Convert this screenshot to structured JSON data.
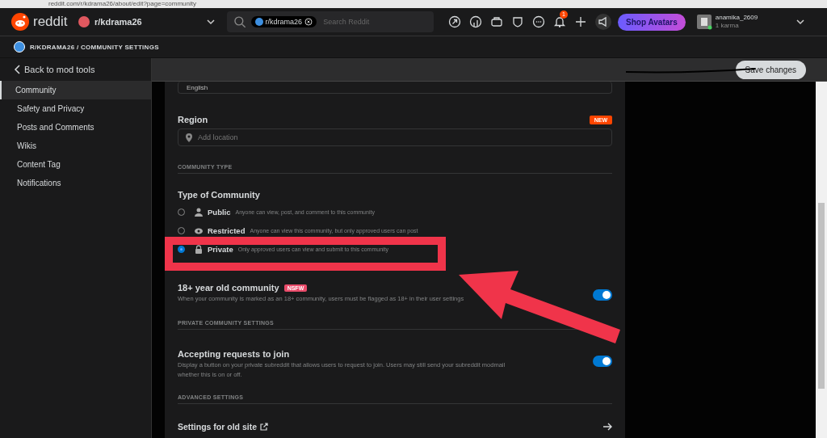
{
  "browser": {
    "url": "reddit.com/r/kdrama26/about/edit?page=community"
  },
  "header": {
    "logo_text": "reddit",
    "community": "r/kdrama26",
    "search_chip": "r/kdrama26",
    "search_placeholder": "Search Reddit",
    "notification_count": "1",
    "shop_button": "Shop Avatars",
    "username": "anamika_2609",
    "karma": "1 karma"
  },
  "breadcrumb": "R/KDRAMA26 / COMMUNITY SETTINGS",
  "sidebar": {
    "back_link": "Back to mod tools",
    "items": [
      {
        "label": "Community",
        "selected": true
      },
      {
        "label": "Safety and Privacy",
        "selected": false
      },
      {
        "label": "Posts and Comments",
        "selected": false
      },
      {
        "label": "Wikis",
        "selected": false
      },
      {
        "label": "Content Tag",
        "selected": false
      },
      {
        "label": "Notifications",
        "selected": false
      }
    ]
  },
  "toolbar": {
    "save_button": "Save changes"
  },
  "settings": {
    "language_value": "English",
    "region": {
      "label": "Region",
      "badge": "NEW",
      "placeholder": "Add location"
    },
    "community_type_heading": "COMMUNITY TYPE",
    "type_title": "Type of Community",
    "options": [
      {
        "kind": "public",
        "label": "Public",
        "description": "Anyone can view, post, and comment to this community",
        "selected": false
      },
      {
        "kind": "restricted",
        "label": "Restricted",
        "description": "Anyone can view this community, but only approved users can post",
        "selected": false
      },
      {
        "kind": "private",
        "label": "Private",
        "description": "Only approved users can view and submit to this community",
        "selected": true
      }
    ],
    "nsfw": {
      "title": "18+ year old community",
      "badge": "NSFW",
      "description": "When your community is marked as an 18+ community, users must be flagged as 18+ in their user settings",
      "on": true
    },
    "private_heading": "PRIVATE COMMUNITY SETTINGS",
    "requests": {
      "title": "Accepting requests to join",
      "description": "Display a button on your private subreddit that allows users to request to join. Users may still send your subreddit modmail whether this is on or off.",
      "on": true
    },
    "advanced_heading": "ADVANCED SETTINGS",
    "old_site_link": "Settings for old site"
  }
}
